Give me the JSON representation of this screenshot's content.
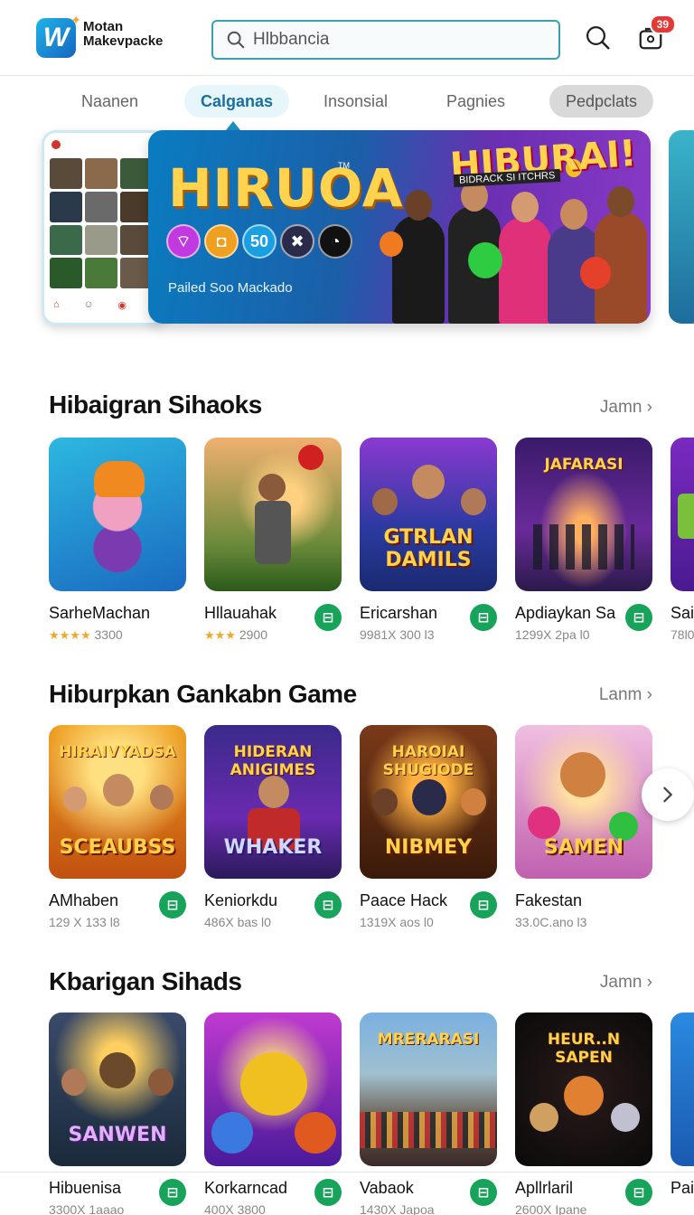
{
  "header": {
    "logo_text_line1": "Motan",
    "logo_text_line2": "Makevpacke",
    "logo_letter": "W",
    "search_value": "Hlbbancia",
    "notification_count": "39"
  },
  "tabs": [
    {
      "label": "Naanen"
    },
    {
      "label": "Calganas"
    },
    {
      "label": "Insonsial"
    },
    {
      "label": "Pagnies"
    },
    {
      "label": "Pedpclats"
    }
  ],
  "banner": {
    "title": "HIRUOA",
    "tm": "TM",
    "circle_label": "50",
    "subtitle": "Pailed Soo Mackado",
    "headline": "HIBURAI!",
    "subheadline": "BIDRACK SI ITCHRS"
  },
  "sections": [
    {
      "title": "Hibaigran Sihaoks",
      "see_more": "Jamn",
      "items": [
        {
          "name": "SarheMachan",
          "rating": "★★★★",
          "meta": "3300",
          "art_top": "",
          "art_text": ""
        },
        {
          "name": "Hllauahak",
          "rating": "★★★",
          "meta": "2900",
          "art_top": "",
          "art_text": ""
        },
        {
          "name": "Ericarshan",
          "rating": "",
          "meta": "9981X 300 l3",
          "art_top": "",
          "art_text": "GTRLAN DAMILS"
        },
        {
          "name": "Apdiaykan Sa",
          "rating": "",
          "meta": "1299X 2pa l0",
          "art_top": "JAFARASI",
          "art_text": ""
        },
        {
          "name": "Sai",
          "rating": "",
          "meta": "78l0",
          "art_top": "",
          "art_text": ""
        }
      ]
    },
    {
      "title": "Hiburpkan Gankabn Game",
      "see_more": "Lanm",
      "items": [
        {
          "name": "AMhaben",
          "rating": "",
          "meta": "129 X 133 l8",
          "art_top": "HIRAIVYADSA",
          "art_text": "SCEAUBSS"
        },
        {
          "name": "Keniorkdu",
          "rating": "",
          "meta": "486X bas l0",
          "art_top": "HIDERAN ANIGIMES",
          "art_text": "WHAKER"
        },
        {
          "name": "Paace Hack",
          "rating": "",
          "meta": "1319X aos l0",
          "art_top": "HAROIAI SHUGIODE",
          "art_text": "NIBMEY"
        },
        {
          "name": "Fakestan",
          "rating": "",
          "meta": "33.0C.ano l3",
          "art_top": "",
          "art_text": "SAMEN"
        }
      ]
    },
    {
      "title": "Kbarigan Sihads",
      "see_more": "Jamn",
      "items": [
        {
          "name": "Hibuenisa",
          "rating": "",
          "meta": "3300X 1aaao",
          "art_top": "",
          "art_text": "SANWEN"
        },
        {
          "name": "Korkarncad",
          "rating": "",
          "meta": "400X 3800",
          "art_top": "",
          "art_text": ""
        },
        {
          "name": "Vabaok",
          "rating": "",
          "meta": "1430X Japoa",
          "art_top": "MRERARASI",
          "art_text": ""
        },
        {
          "name": "Apllrlaril",
          "rating": "",
          "meta": "2600X Ipane",
          "art_top": "HEUR..N SAPEN",
          "art_text": ""
        },
        {
          "name": "Pai",
          "rating": "",
          "meta": "",
          "art_top": "",
          "art_text": ""
        }
      ]
    }
  ],
  "colors": {
    "accent": "#1e90c0",
    "get_button": "#17a35a",
    "badge": "#e53935"
  }
}
